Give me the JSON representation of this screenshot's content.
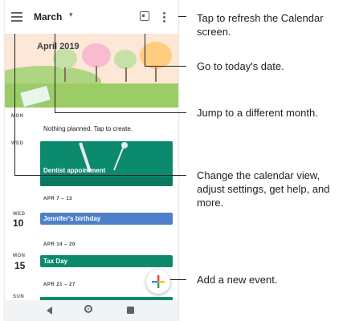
{
  "header": {
    "month_title": "March",
    "caret": "▾"
  },
  "banner": {
    "title": "April 2019"
  },
  "agenda": {
    "mon_label": "MON",
    "empty_text": "Nothing planned. Tap to create.",
    "wed_label": "WED",
    "dentist_event": "Dentist appointment",
    "week1": "APR 7 – 13",
    "wed_label2": "WED",
    "wed_num": "10",
    "birthday_event": "Jennifer's birthday",
    "week2": "APR 14 – 20",
    "mon_label2": "MON",
    "mon_num": "15",
    "taxday_event": "Tax Day",
    "week3": "APR 21 – 27",
    "sun_label": "SUN"
  },
  "fab": {
    "glyph": "+"
  },
  "callouts": {
    "refresh": "Tap to refresh the Calendar screen.",
    "today": "Go to today's date.",
    "jump": "Jump to a different month.",
    "view": "Change the calendar view, adjust settings, get help, and more.",
    "add": "Add a new event."
  },
  "colors": {
    "event_green": "#0b8a6e",
    "event_blue": "#4f7fc8",
    "event_teal": "#0b8a6e",
    "fab_green": "#34a853",
    "fab_red": "#ea4335",
    "fab_yellow": "#fbbc04",
    "fab_blue": "#4285f4"
  }
}
